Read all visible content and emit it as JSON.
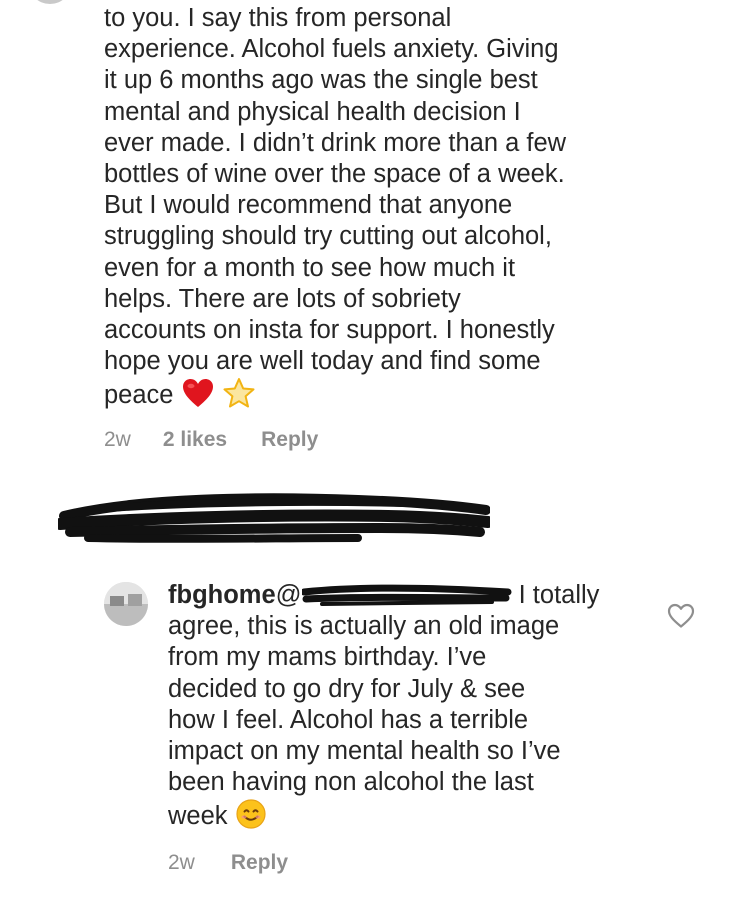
{
  "comment": {
    "lines": [
      "to you. I say this from personal",
      "experience. Alcohol fuels anxiety. Giving",
      "it up 6 months ago was the single best",
      "mental and physical health decision I",
      "ever made. I didn’t drink more than a few",
      "bottles of wine over the space of a week.",
      "But I would recommend that anyone",
      "struggling should try cutting out alcohol,",
      "even for a month to see how much it",
      "helps. There are lots of sobriety",
      "accounts on insta for support. I honestly",
      "hope you are well today and find some",
      "peace"
    ],
    "emojis": [
      "red-heart",
      "star"
    ],
    "time": "2w",
    "likes": "2 likes",
    "reply_label": "Reply"
  },
  "reply": {
    "username": "fbghome",
    "mention_prefix": "@",
    "lines": [
      "I totally",
      "agree, this is actually an old image",
      "from my mams birthday. I’ve",
      "decided to go dry for July & see",
      "how I feel. Alcohol has a terrible",
      "impact on my mental health so I’ve",
      "been having non alcohol the last",
      "week"
    ],
    "emoji": "smiling-face",
    "time": "2w",
    "reply_label": "Reply"
  },
  "colors": {
    "text": "#262626",
    "meta": "#8e8e8e",
    "redaction": "#111111"
  }
}
